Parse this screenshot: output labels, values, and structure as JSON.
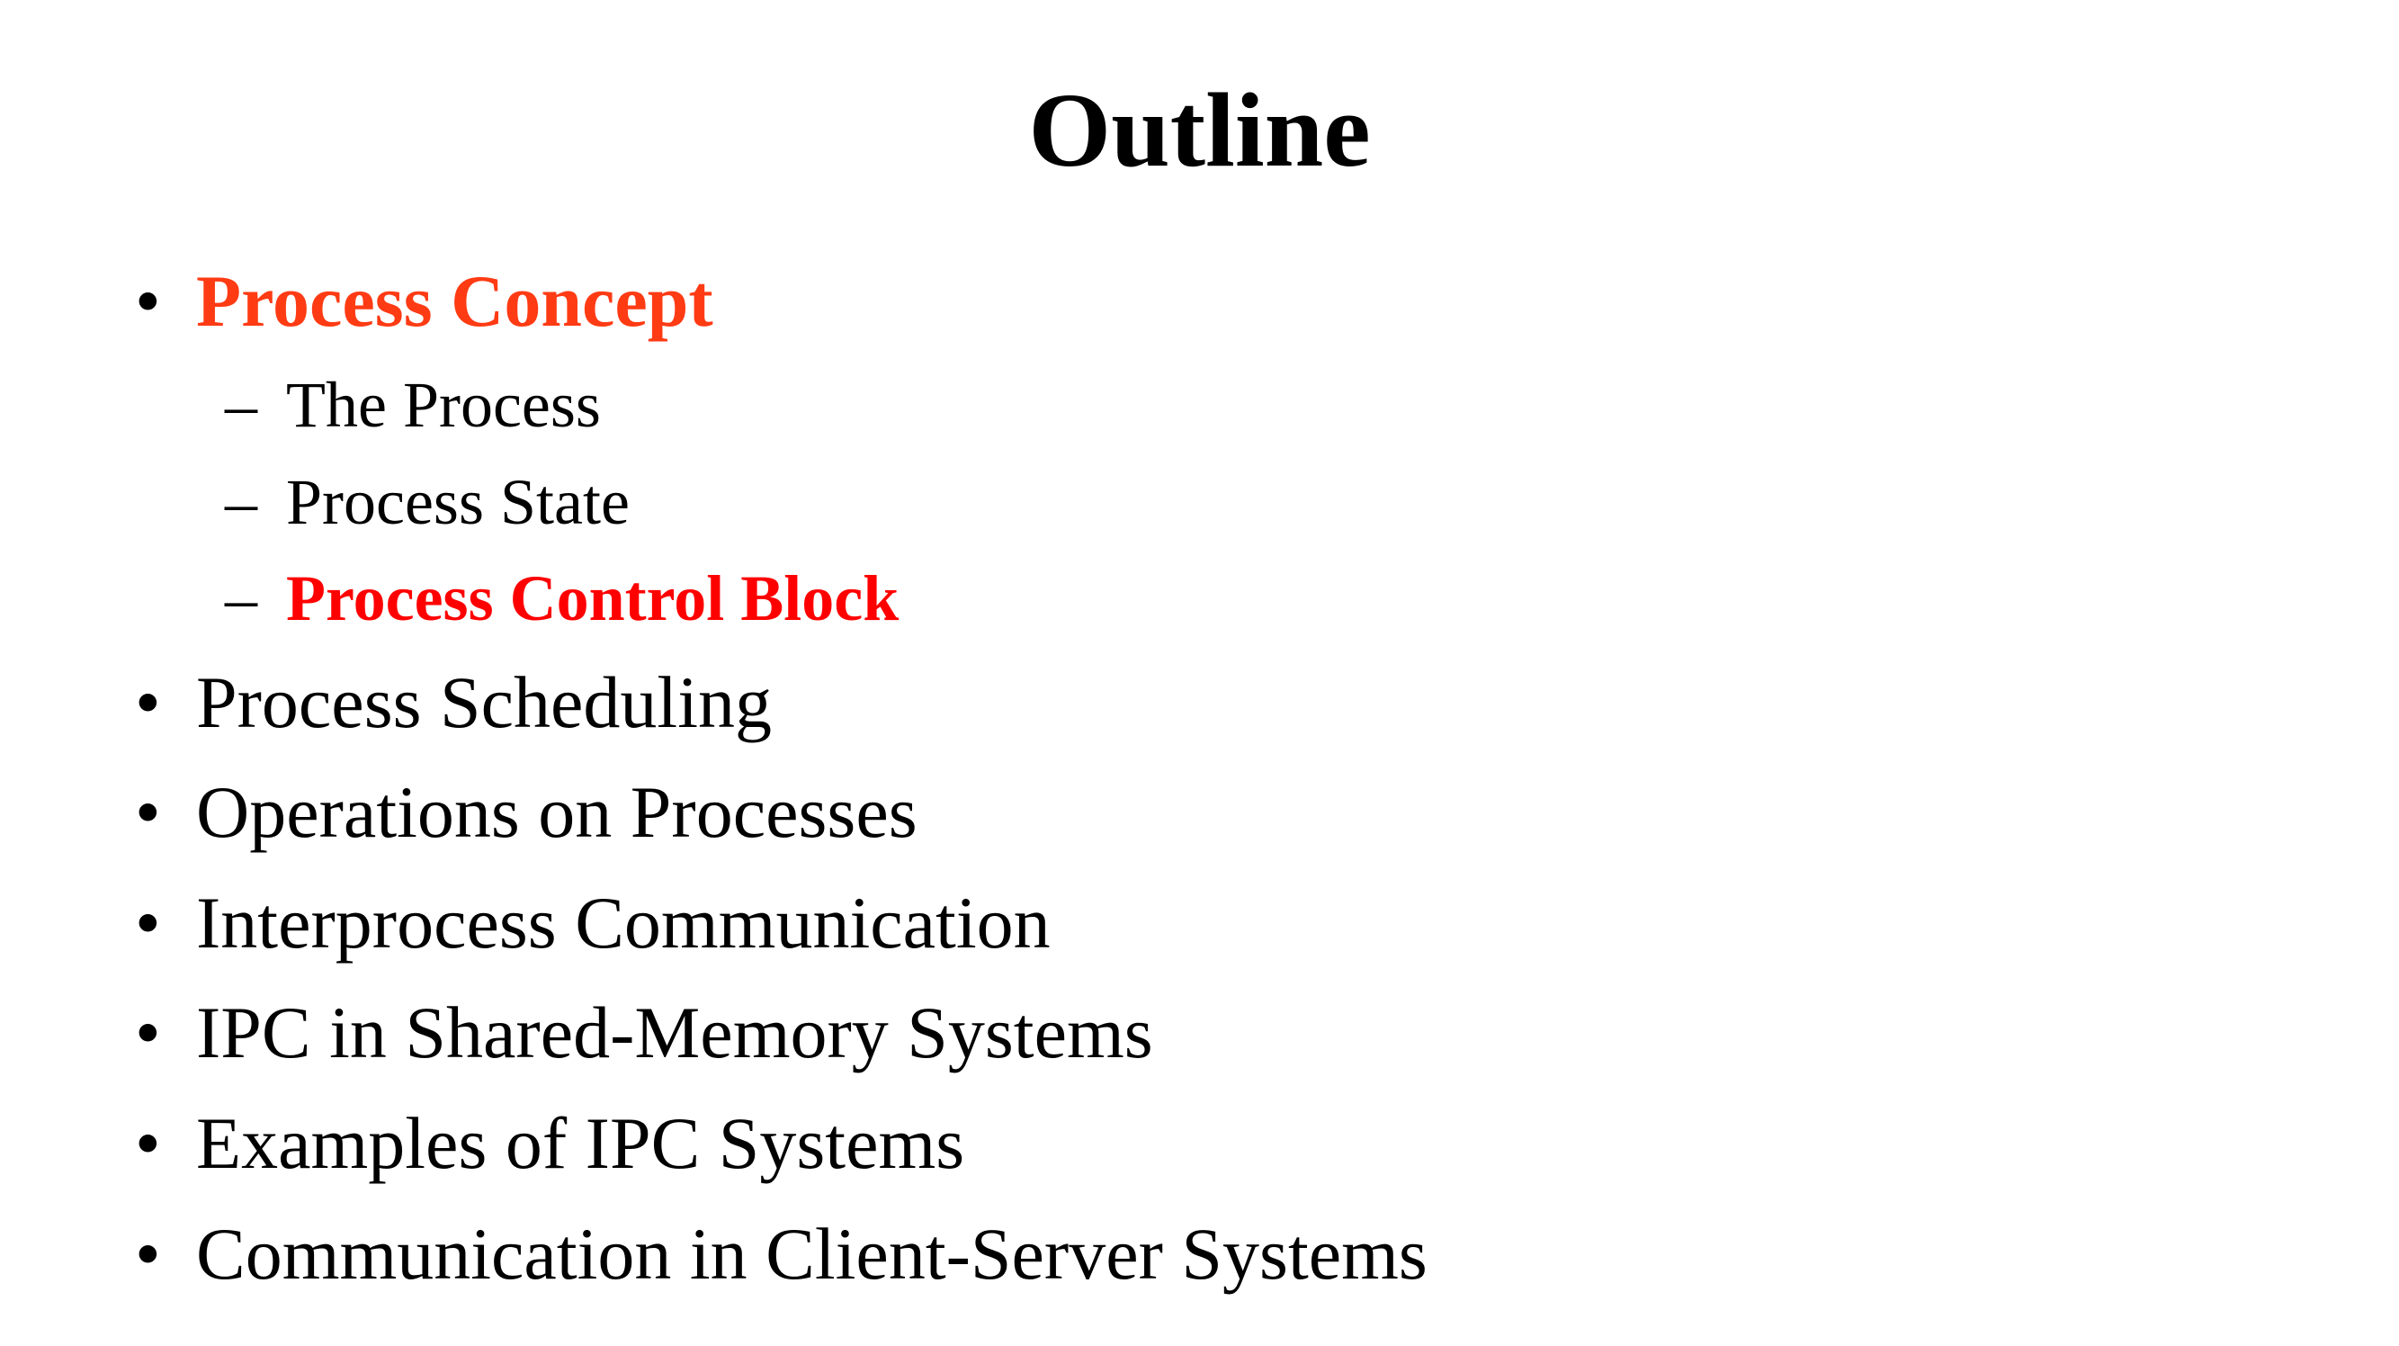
{
  "slide": {
    "title": "Outline",
    "bullet_glyph": "•",
    "dash_glyph": "–",
    "colors": {
      "highlight_section": "#ff3b14",
      "highlight_subsection": "#ff0000",
      "text": "#000000",
      "background": "#ffffff"
    },
    "items": [
      {
        "label": "Process Concept",
        "level": 1,
        "highlighted": true
      },
      {
        "label": "The Process",
        "level": 2,
        "highlighted": false
      },
      {
        "label": "Process State",
        "level": 2,
        "highlighted": false
      },
      {
        "label": "Process Control Block",
        "level": 2,
        "highlighted": true
      },
      {
        "label": "Process Scheduling",
        "level": 1,
        "highlighted": false
      },
      {
        "label": "Operations on Processes",
        "level": 1,
        "highlighted": false
      },
      {
        "label": "Interprocess Communication",
        "level": 1,
        "highlighted": false
      },
      {
        "label": "IPC in Shared-Memory Systems",
        "level": 1,
        "highlighted": false
      },
      {
        "label": "Examples of IPC Systems",
        "level": 1,
        "highlighted": false
      },
      {
        "label": "Communication in Client-Server Systems",
        "level": 1,
        "highlighted": false
      }
    ]
  }
}
